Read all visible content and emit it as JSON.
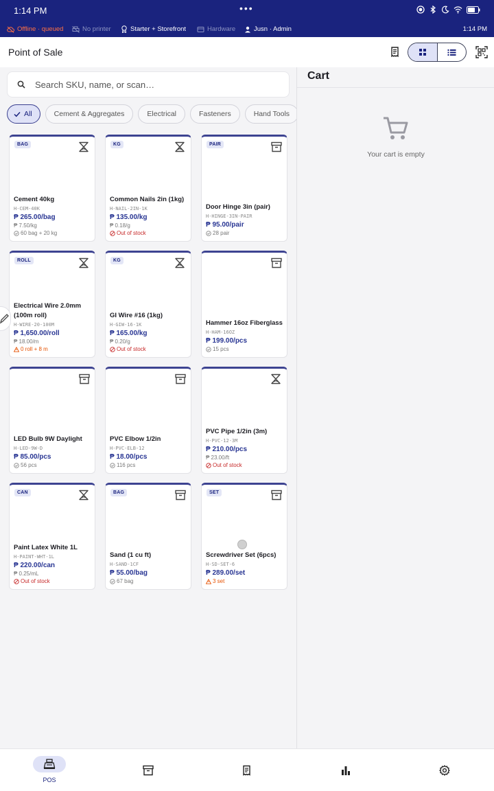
{
  "status_bar": {
    "time": "1:14 PM",
    "menu_dots": "•••"
  },
  "info_bar": {
    "offline": "Offline · queued",
    "printer": "No printer",
    "plan": "Starter + Storefront",
    "hardware": "Hardware",
    "user": "Jusn · Admin",
    "clock": "1:14 PM"
  },
  "app_bar": {
    "title": "Point of Sale"
  },
  "search": {
    "placeholder": "Search SKU, name, or scan…"
  },
  "chips": [
    "All",
    "Cement & Aggregates",
    "Electrical",
    "Fasteners",
    "Hand Tools"
  ],
  "products": [
    {
      "badge": "BAG",
      "kind": "scale",
      "name": "Cement 40kg",
      "sku": "H-CEM-40K",
      "price": "₱ 265.00/bag",
      "unit_price": "₱ 7.50/kg",
      "stock": "60 bag + 20 kg",
      "stock_status": "ok"
    },
    {
      "badge": "KG",
      "kind": "scale",
      "name": "Common Nails 2in (1kg)",
      "sku": "H-NAIL-2IN-1K",
      "price": "₱ 135.00/kg",
      "unit_price": "₱ 0.18/g",
      "stock": "Out of stock",
      "stock_status": "out"
    },
    {
      "badge": "PAIR",
      "kind": "box",
      "name": "Door Hinge 3in (pair)",
      "sku": "H-HINGE-3IN-PAIR",
      "price": "₱ 95.00/pair",
      "unit_price": "",
      "stock": "28 pair",
      "stock_status": "ok"
    },
    {
      "badge": "ROLL",
      "kind": "scale",
      "name": "Electrical Wire 2.0mm (100m roll)",
      "sku": "H-WIRE-20-100M",
      "price": "₱ 1,650.00/roll",
      "unit_price": "₱ 18.00/m",
      "stock": "0 roll + 8 m",
      "stock_status": "low"
    },
    {
      "badge": "KG",
      "kind": "scale",
      "name": "GI Wire #16 (1kg)",
      "sku": "H-GIW-16-1K",
      "price": "₱ 165.00/kg",
      "unit_price": "₱ 0.20/g",
      "stock": "Out of stock",
      "stock_status": "out"
    },
    {
      "badge": "",
      "kind": "box",
      "name": "Hammer 16oz Fiberglass",
      "sku": "H-HAM-16OZ",
      "price": "₱ 199.00/pcs",
      "unit_price": "",
      "stock": "15 pcs",
      "stock_status": "ok"
    },
    {
      "badge": "",
      "kind": "box",
      "name": "LED Bulb 9W Daylight",
      "sku": "H-LED-9W-D",
      "price": "₱ 85.00/pcs",
      "unit_price": "",
      "stock": "56 pcs",
      "stock_status": "ok"
    },
    {
      "badge": "",
      "kind": "box",
      "name": "PVC Elbow 1/2in",
      "sku": "H-PVC-ELB-12",
      "price": "₱ 18.00/pcs",
      "unit_price": "",
      "stock": "116 pcs",
      "stock_status": "ok"
    },
    {
      "badge": "",
      "kind": "scale",
      "name": "PVC Pipe 1/2in (3m)",
      "sku": "H-PVC-12-3M",
      "price": "₱ 210.00/pcs",
      "unit_price": "₱ 23.00/ft",
      "stock": "Out of stock",
      "stock_status": "out"
    },
    {
      "badge": "CAN",
      "kind": "scale",
      "name": "Paint Latex White 1L",
      "sku": "H-PAINT-WHT-1L",
      "price": "₱ 220.00/can",
      "unit_price": "₱ 0.25/mL",
      "stock": "Out of stock",
      "stock_status": "out"
    },
    {
      "badge": "BAG",
      "kind": "box",
      "name": "Sand (1 cu ft)",
      "sku": "H-SAND-1CF",
      "price": "₱ 55.00/bag",
      "unit_price": "",
      "stock": "67 bag",
      "stock_status": "ok"
    },
    {
      "badge": "SET",
      "kind": "box",
      "name": "Screwdriver Set (6pcs)",
      "sku": "H-SD-SET-6",
      "price": "₱ 289.00/set",
      "unit_price": "",
      "stock": "3 set",
      "stock_status": "low"
    }
  ],
  "cart": {
    "title": "Cart",
    "empty_message": "Your cart is empty"
  },
  "bottom_nav": [
    {
      "icon": "register-icon",
      "label": "POS",
      "active": true
    },
    {
      "icon": "inventory-icon",
      "label": "",
      "active": false
    },
    {
      "icon": "receipt-icon",
      "label": "",
      "active": false
    },
    {
      "icon": "bar-chart-icon",
      "label": "",
      "active": false
    },
    {
      "icon": "gear-icon",
      "label": "",
      "active": false
    }
  ],
  "colors": {
    "primary": "#1a237e",
    "accent": "#283593",
    "offline": "#ff7043",
    "out_of_stock": "#c62828",
    "low_stock": "#e65100"
  }
}
